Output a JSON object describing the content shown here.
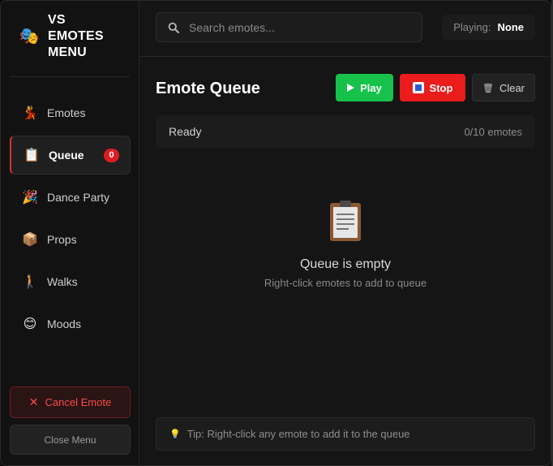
{
  "brand": {
    "icon": "🎭",
    "title": "VS EMOTES MENU"
  },
  "sidebar": {
    "items": [
      {
        "icon": "💃",
        "label": "Emotes"
      },
      {
        "icon": "📋",
        "label": "Queue",
        "badge": "0",
        "active": true
      },
      {
        "icon": "🎉",
        "label": "Dance Party"
      },
      {
        "icon": "📦",
        "label": "Props"
      },
      {
        "icon": "🚶",
        "label": "Walks"
      },
      {
        "icon": "😊",
        "label": "Moods"
      }
    ],
    "cancel_label": "Cancel Emote",
    "close_label": "Close Menu"
  },
  "header": {
    "search_placeholder": "Search emotes...",
    "playing_label": "Playing:",
    "playing_value": "None"
  },
  "main": {
    "title": "Emote Queue",
    "play_label": "Play",
    "stop_label": "Stop",
    "clear_label": "Clear",
    "status": "Ready",
    "count": "0/10 emotes",
    "empty_title": "Queue is empty",
    "empty_sub": "Right-click emotes to add to queue",
    "tip_icon": "💡",
    "tip": "Tip: Right-click any emote to add it to the queue"
  },
  "colors": {
    "accent_red": "#e01b24",
    "play_green": "#16c24a",
    "stop_red": "#ea1c1c",
    "background": "#151515"
  }
}
